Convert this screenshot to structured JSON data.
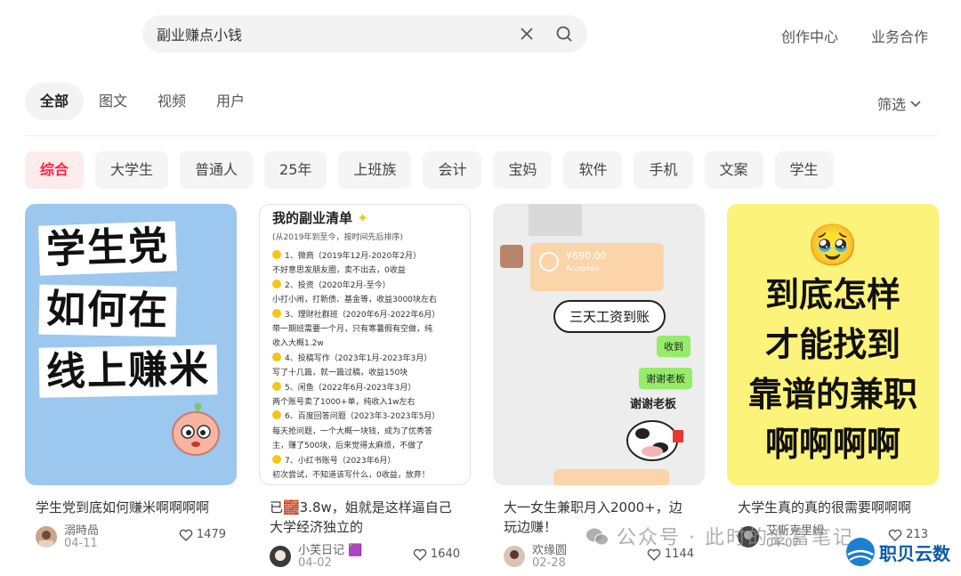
{
  "search": {
    "query": "副业赚点小钱"
  },
  "header_links": {
    "creator": "创作中心",
    "business": "业务合作"
  },
  "type_tabs": [
    "全部",
    "图文",
    "视频",
    "用户"
  ],
  "filter": {
    "label": "筛选"
  },
  "chips": [
    "综合",
    "大学生",
    "普通人",
    "25年",
    "上班族",
    "会计",
    "宝妈",
    "软件",
    "手机",
    "文案",
    "学生"
  ],
  "cards": [
    {
      "title": "学生党到底如何赚米啊啊啊啊",
      "author": "溺時咼",
      "date": "04-11",
      "likes": "1479",
      "cover_text": [
        "学生党",
        "如何在",
        "线上赚米"
      ]
    },
    {
      "title": "已🧱3.8w，姐就是这样逼自己大学经济独立的",
      "author": "小芙日记 🟪",
      "date": "04-02",
      "likes": "1640",
      "cover_heading": "我的副业清单",
      "cover_sub": "(从2019年到至今，按时间先后排序)",
      "cover_lines": [
        "1、微商（2019年12月-2020年2月）",
        "不好意思发朋友圈，卖不出去，0收益",
        "2、投资（2020年2月-至今）",
        "小打小闹，打新债、基金等，收益3000块左右",
        "3、理财社群班（2020年6月-2022年6月）",
        "带一期班需要一个月，只有寒暑假有空做，纯",
        "收入大概1.2w",
        "4、投稿写作（2023年1月-2023年3月）",
        "写了十几篇，就一篇过稿，收益150块",
        "5、闲鱼（2022年6月-2023年3月）",
        "两个账号卖了1000+单，纯收入1w左右",
        "6、百度回答问题（2023年3-2023年5月）",
        "每天抢问题，一个大概一块钱，成为了优秀答",
        "主，赚了500块，后来觉得太麻烦，不做了",
        "7、小红书账号（2023年6月）",
        "初次尝试，不知道该写什么，0收益，放弃！"
      ]
    },
    {
      "title": "大一女生兼职月入2000+，边玩边赚！",
      "author": "欢缘圆",
      "date": "02-28",
      "likes": "1144",
      "cover_transfer": "¥690.00",
      "cover_accepted": "Accepted",
      "cover_bubble": "三天工资到账",
      "cover_msg1": "收到",
      "cover_msg2": "谢谢老板",
      "cover_sticker": "谢谢老板"
    },
    {
      "title": "大学生真的真的很需要啊啊啊",
      "author": "艾斯克里姆",
      "date": "04-07",
      "likes": "213",
      "cover_emoji": "🥹",
      "cover_text": [
        "到底怎样",
        "才能找到",
        "靠谱的兼职",
        "啊啊啊啊"
      ]
    }
  ],
  "watermark": {
    "text": "公众号 · 此时的变富笔记",
    "brand": "职贝云数"
  },
  "colors": {
    "accent": "#ff2442",
    "chip_active_bg": "#fdecec"
  }
}
